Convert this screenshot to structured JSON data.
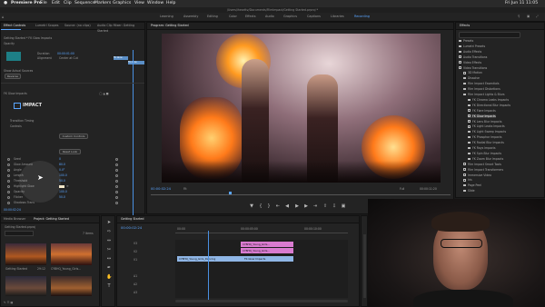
{
  "menubar": {
    "apple": "",
    "app": "Premiere Pro",
    "items": [
      "File",
      "Edit",
      "Clip",
      "Sequence",
      "Markers",
      "Graphics",
      "View",
      "Window",
      "Help"
    ],
    "clock": "Fri Jun 11  11:05 AM"
  },
  "path_text": "/Users/ihearttv/Documents/FilmImpact/Getting Started.prproj *",
  "workspaces": [
    "Learning",
    "Assembly",
    "Editing",
    "Color",
    "Effects",
    "Audio",
    "Graphics",
    "Captions",
    "Libraries",
    "Recording"
  ],
  "active_workspace": "Recording",
  "effect_controls": {
    "tabs": [
      "Effect Controls",
      "Lumetri Scopes",
      "Source: (no clips)",
      "Audio Clip Mixer: Getting Started"
    ],
    "source_line": "Getting Started * FK Glow Impacts",
    "opacity_label": "Opacity",
    "blend_label": "Blend Mode",
    "blend_value": "Normal",
    "alignment_label": "Alignment",
    "alignment_value": "Center at Cut",
    "duration_label": "Duration",
    "duration_value": "00:00:01:00",
    "show_sources_label": "Show Actual Sources",
    "reverse_label": "Reverse",
    "clip_labels": [
      "FK Glow Impacts",
      "FK Glow Impacts"
    ],
    "effect_name": "FK Glow Impacts",
    "logo_text": "IMPACT",
    "transition_timing": "Transition Timing",
    "controls_label": "Controls",
    "custom_button": "Custom Controls",
    "reset_button": "Reset Look",
    "params": [
      {
        "name": "Seed",
        "value": "0"
      },
      {
        "name": "Glow Amount",
        "value": "80.0"
      },
      {
        "name": "Angle",
        "value": "0.0°"
      },
      {
        "name": "Length",
        "value": "100.0"
      },
      {
        "name": "Threshold",
        "value": "50.0"
      },
      {
        "name": "Highlight Glow",
        "value": ""
      },
      {
        "name": "Opacity",
        "value": "100.0"
      },
      {
        "name": "Flicker",
        "value": "50.0"
      },
      {
        "name": "Shadows Trans",
        "value": ""
      }
    ],
    "timecode": "00:00:02:24"
  },
  "program": {
    "title": "Program: Getting Started",
    "timecode": "00:00:02:24",
    "fit": "Fit",
    "quality": "Full",
    "duration": "00:00:11:20"
  },
  "effects": {
    "title": "Effects",
    "search_placeholder": "",
    "items": [
      {
        "label": "Presets",
        "level": 0
      },
      {
        "label": "Lumetri Presets",
        "level": 0
      },
      {
        "label": "Audio Effects",
        "level": 0
      },
      {
        "label": "Audio Transitions",
        "level": 0
      },
      {
        "label": "Video Effects",
        "level": 0
      },
      {
        "label": "Video Transitions",
        "level": 0
      },
      {
        "label": "3D Motion",
        "level": 1
      },
      {
        "label": "Dissolve",
        "level": 1
      },
      {
        "label": "Film Impact Essentials",
        "level": 1
      },
      {
        "label": "Film Impact Distortions",
        "level": 1
      },
      {
        "label": "Film Impact Lights & Blurs",
        "level": 1
      },
      {
        "label": "FK Chroma Leaks Impacts",
        "level": 2
      },
      {
        "label": "FK Directional Blur Impacts",
        "level": 2
      },
      {
        "label": "FK Flare Impacts",
        "level": 2
      },
      {
        "label": "FK Glow Impacts",
        "level": 2
      },
      {
        "label": "FK Lens Blur Impacts",
        "level": 2
      },
      {
        "label": "FK Light Leaks Impacts",
        "level": 2
      },
      {
        "label": "FK Light Sweep Impacts",
        "level": 2
      },
      {
        "label": "FK Phosphor Impacts",
        "level": 2
      },
      {
        "label": "FK Radial Blur Impacts",
        "level": 2
      },
      {
        "label": "FK Rays Impacts",
        "level": 2
      },
      {
        "label": "FK Spin Blur Impacts",
        "level": 2
      },
      {
        "label": "FK Zoom Blur Impacts",
        "level": 2
      },
      {
        "label": "Film Impact Smart Tools",
        "level": 1
      },
      {
        "label": "Film Impact Transformers",
        "level": 1
      },
      {
        "label": "Immersive Video",
        "level": 1
      },
      {
        "label": "Iris",
        "level": 1
      },
      {
        "label": "Page Peel",
        "level": 1
      },
      {
        "label": "Slide",
        "level": 1
      }
    ]
  },
  "project": {
    "tabs": [
      "Media Browser",
      "Project: Getting Started"
    ],
    "file": "Getting Started.prproj",
    "count": "7 Items",
    "thumbs": [
      {
        "name": "Getting Started",
        "dur": "29:12"
      },
      {
        "name": "CYBHQ_Young_Girls...",
        "dur": "22:13"
      },
      {
        "name": "",
        "dur": ""
      },
      {
        "name": "",
        "dur": ""
      }
    ]
  },
  "timeline": {
    "tab": "Getting Started",
    "timecode": "00:00:02:24",
    "ruler": [
      "00:00",
      "00:00:05:00",
      "00:00:10:00"
    ],
    "tracks": [
      "V3",
      "V2",
      "V1",
      "A1",
      "A2",
      "A3"
    ],
    "clips": [
      {
        "label": "CYBHQ_Young_Girls...",
        "track": "V2"
      },
      {
        "label": "CYBHQ_Young_Girls...",
        "track": "V2b"
      },
      {
        "label": "CYBHQ_Young_Girls_Dancing",
        "track": "V1"
      },
      {
        "label": "FK Glow Impacts",
        "track": "V1b"
      }
    ]
  },
  "colors": {
    "accent": "#5aa5ff",
    "clip_pink": "#d97bd0",
    "clip_blue": "#8fb6e6",
    "playhead": "#4a90e2"
  }
}
